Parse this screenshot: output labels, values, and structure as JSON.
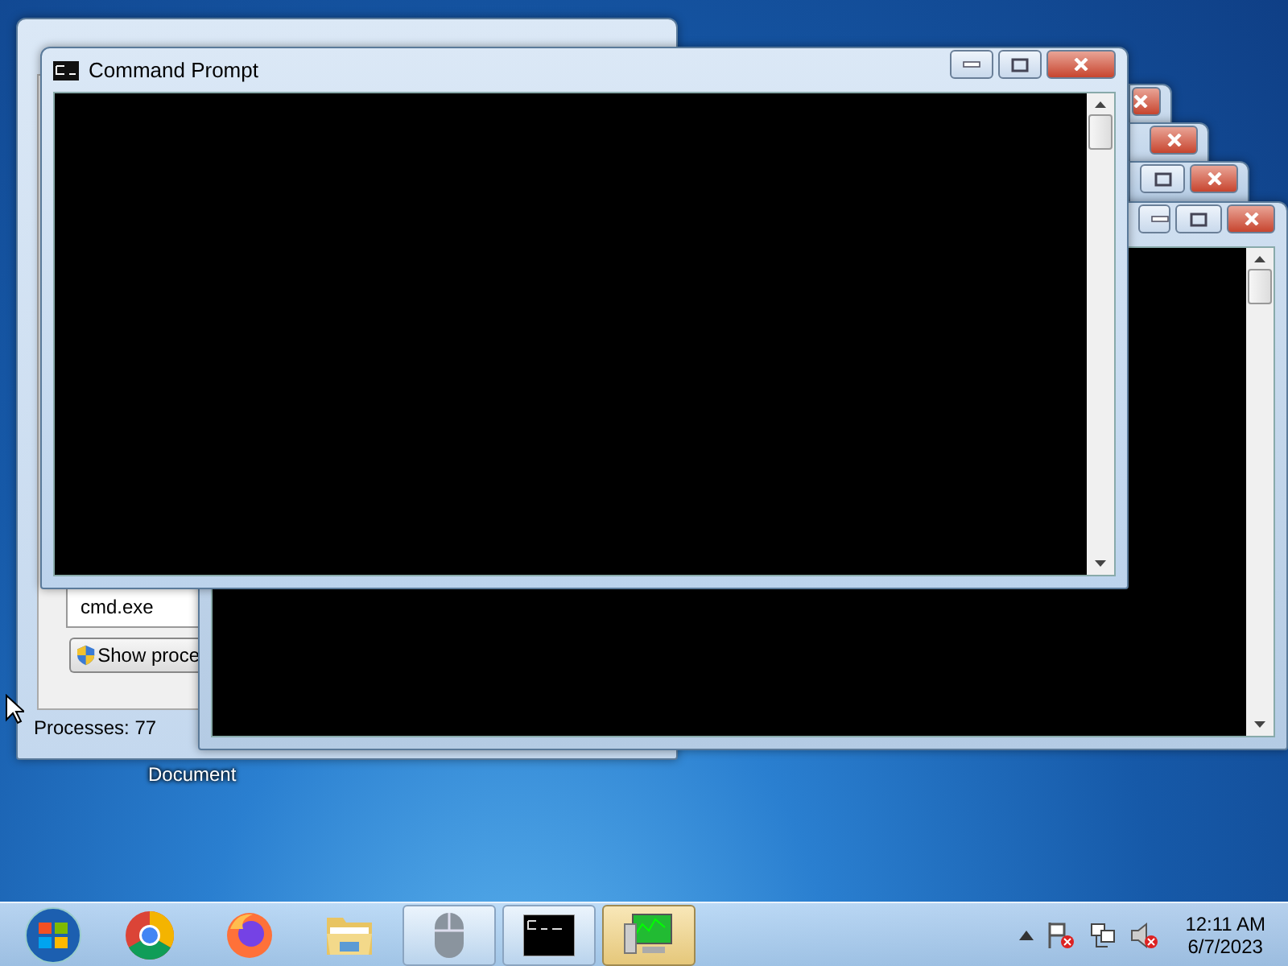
{
  "task_manager": {
    "process_item": "cmd.exe",
    "show_button": "Show proce",
    "status": "Processes: 77"
  },
  "cmd_windows": [
    {
      "active": false
    },
    {
      "active": false
    },
    {
      "active": false
    },
    {
      "active": false
    },
    {
      "title": "Command Prompt",
      "active": true
    }
  ],
  "desktop_icons": [
    {
      "label": "Document"
    }
  ],
  "taskbar": {
    "items": [
      {
        "kind": "chrome",
        "selected": false
      },
      {
        "kind": "firefox",
        "selected": false
      },
      {
        "kind": "explorer",
        "selected": false
      },
      {
        "kind": "mouse",
        "selected": false
      },
      {
        "kind": "cmd",
        "selected": false
      },
      {
        "kind": "taskmgr",
        "selected": true
      }
    ],
    "time": "12:11 AM",
    "date": "6/7/2023"
  }
}
